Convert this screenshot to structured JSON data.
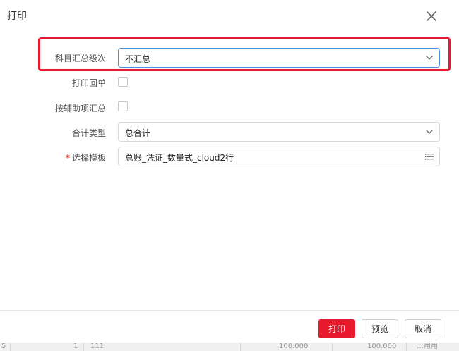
{
  "dialog": {
    "title": "打印",
    "close_icon": "close-icon"
  },
  "form": {
    "summary_level": {
      "label": "科目汇总级次",
      "value": "不汇总",
      "icon": "chevron-down-icon"
    },
    "print_receipt": {
      "label": "打印回单",
      "checked": false
    },
    "aux_summary": {
      "label": "按辅助项汇总",
      "checked": false
    },
    "total_type": {
      "label": "合计类型",
      "value": "总合计",
      "icon": "chevron-down-icon"
    },
    "template": {
      "required_mark": "*",
      "label": "选择模板",
      "value": "总账_凭证_数量式_cloud2行",
      "icon": "list-icon"
    }
  },
  "buttons": {
    "print": "打印",
    "preview": "预览",
    "cancel": "取消"
  },
  "background_row": {
    "cells": [
      "5",
      "1",
      "111",
      "100.000",
      "100.000",
      "…用用"
    ]
  },
  "colors": {
    "primary": "#e8192c",
    "highlight_border": "#e8192c",
    "focus_border": "#4a90e2",
    "required": "#e53935"
  }
}
